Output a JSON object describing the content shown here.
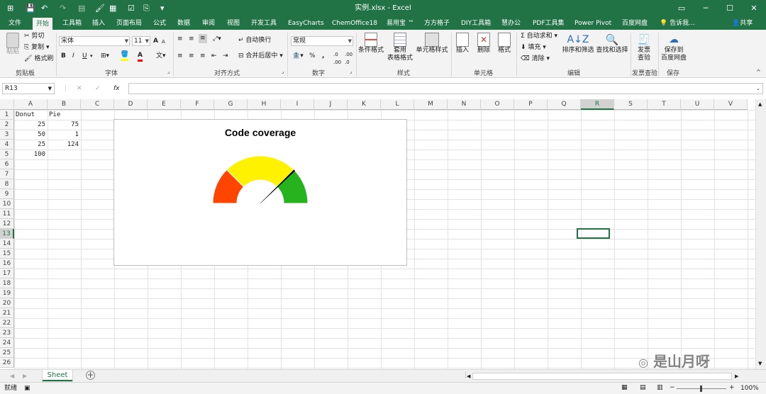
{
  "window": {
    "title": "实例.xlsx - Excel",
    "minimize": "─",
    "restore": "❐",
    "maximize": "☐",
    "close": "✕"
  },
  "quick_access": {
    "save": "💾",
    "undo": "↶",
    "redo": "↷",
    "format_painter": "🖌",
    "more": "▾"
  },
  "tabs": [
    {
      "label": "文件"
    },
    {
      "label": "开始"
    },
    {
      "label": "工具箱"
    },
    {
      "label": "插入"
    },
    {
      "label": "页面布局"
    },
    {
      "label": "公式"
    },
    {
      "label": "数据"
    },
    {
      "label": "审阅"
    },
    {
      "label": "视图"
    },
    {
      "label": "开发工具"
    },
    {
      "label": "EasyCharts"
    },
    {
      "label": "ChemOffice18"
    },
    {
      "label": "易用宝 ™"
    },
    {
      "label": "方方格子"
    },
    {
      "label": "DIY工具箱"
    },
    {
      "label": "慧办公"
    },
    {
      "label": "PDF工具集"
    },
    {
      "label": "Power Pivot"
    },
    {
      "label": "百度网盘"
    }
  ],
  "tell_me": "告诉我...",
  "share": "共享",
  "ribbon": {
    "clipboard": {
      "label": "剪贴板",
      "paste": "粘贴",
      "cut": "剪切",
      "copy": "复制",
      "painter": "格式刷"
    },
    "font": {
      "label": "字体",
      "font_name": "宋体",
      "font_size": "11",
      "bold": "B",
      "italic": "I",
      "underline": "U",
      "grow": "A",
      "shrink": "A",
      "color": "A"
    },
    "alignment": {
      "label": "对齐方式",
      "wrap": "自动换行",
      "merge": "合并后居中"
    },
    "number": {
      "label": "数字",
      "format": "常规",
      "percent": "%",
      "comma": ","
    },
    "styles": {
      "label": "样式",
      "conditional": "条件格式",
      "table_line1": "套用",
      "table_line2": "表格格式",
      "cell_styles": "单元格样式"
    },
    "cells": {
      "label": "单元格",
      "insert": "插入",
      "delete": "删除",
      "format": "格式"
    },
    "editing": {
      "label": "编辑",
      "autosum": "自动求和",
      "fill": "填充",
      "clear": "清除",
      "sort": "排序和筛选",
      "find": "查找和选择"
    },
    "invoice": {
      "label": "发票查验",
      "btn1": "发票",
      "btn2": "查验"
    },
    "save": {
      "label": "保存",
      "btn1": "保存到",
      "btn2": "百度网盘"
    }
  },
  "formula_bar": {
    "name_box": "R13",
    "fx": "fx",
    "cancel": "✕",
    "confirm": "✓",
    "value": ""
  },
  "grid": {
    "columns": [
      "A",
      "B",
      "C",
      "D",
      "E",
      "F",
      "G",
      "H",
      "I",
      "J",
      "K",
      "L",
      "M",
      "N",
      "O",
      "P",
      "Q",
      "R",
      "S",
      "T",
      "U",
      "V"
    ],
    "rows": [
      "1",
      "2",
      "3",
      "4",
      "5",
      "6",
      "7",
      "8",
      "9",
      "10",
      "11",
      "12",
      "13",
      "14",
      "15",
      "16",
      "17",
      "18",
      "19",
      "20",
      "21",
      "22",
      "23",
      "24",
      "25",
      "26"
    ],
    "selected_col": "R",
    "selected_row": "13",
    "cells": {
      "A1": "Donut",
      "B1": "Pie",
      "A2": "25",
      "B2": "75",
      "A3": "50",
      "B3": "1",
      "A4": "25",
      "B4": "124",
      "A5": "100"
    }
  },
  "chart_data": {
    "type": "gauge",
    "title": "Code coverage",
    "donut": {
      "values": [
        25,
        50,
        25,
        100
      ],
      "colors": [
        "#ff4500",
        "#fff200",
        "#26b31d",
        "none"
      ]
    },
    "pie": {
      "values": [
        75,
        1,
        124
      ],
      "colors": [
        "none",
        "#000000",
        "none"
      ]
    }
  },
  "sheet": {
    "tab": "Sheet",
    "add": "+"
  },
  "status": {
    "ready": "就绪",
    "zoom": "100%",
    "zoom_minus": "−",
    "zoom_plus": "+"
  },
  "watermark": "是山月呀"
}
